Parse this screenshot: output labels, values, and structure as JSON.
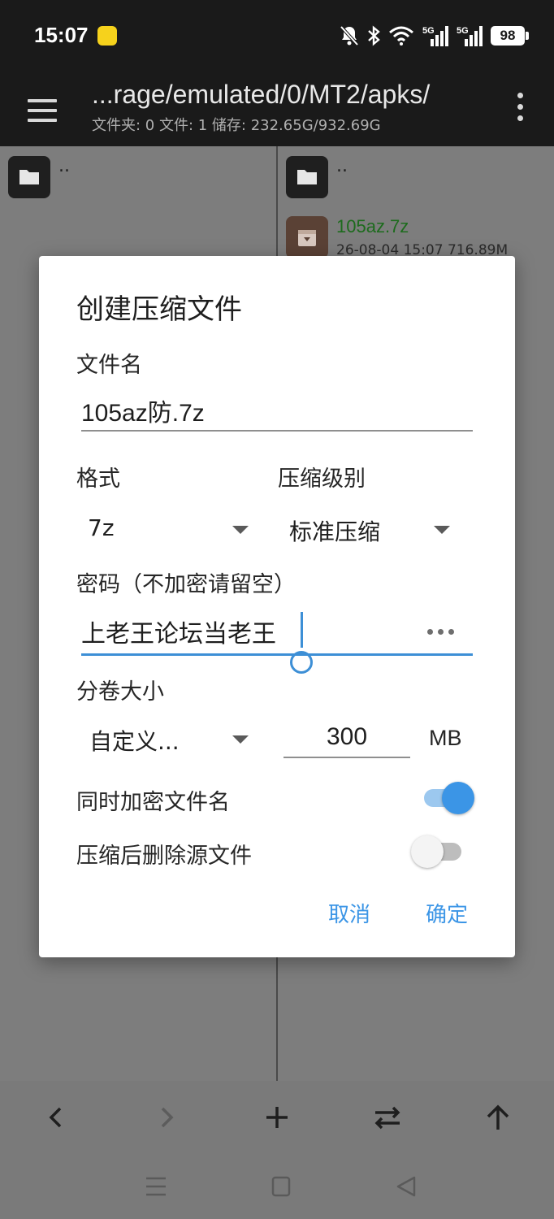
{
  "status_bar": {
    "time": "15:07",
    "battery": "98",
    "icons": [
      "app-badge-icon",
      "bell-off-icon",
      "bluetooth-icon",
      "wifi-icon",
      "signal-5g-icon",
      "signal-5g-icon"
    ]
  },
  "app_bar": {
    "path": "...rage/emulated/0/MT2/apks/",
    "info": "文件夹: 0  文件: 1  储存: 232.65G/932.69G"
  },
  "left_pane": {
    "items": [
      {
        "name": ".."
      }
    ]
  },
  "right_pane": {
    "items": [
      {
        "name": ".."
      },
      {
        "name": "105az.7z",
        "meta": "26-08-04 15:07  716.89M"
      }
    ]
  },
  "dialog": {
    "title": "创建压缩文件",
    "filename_label": "文件名",
    "filename_value": "105az防.7z",
    "format_label": "格式",
    "format_value": "7z",
    "level_label": "压缩级别",
    "level_value": "标准压缩",
    "password_label": "密码（不加密请留空）",
    "password_value": "上老王论坛当老王",
    "volume_label": "分卷大小",
    "volume_mode": "自定义...",
    "volume_size": "300",
    "volume_unit": "MB",
    "encrypt_names_label": "同时加密文件名",
    "encrypt_names_on": true,
    "delete_source_label": "压缩后删除源文件",
    "delete_source_on": false,
    "cancel_label": "取消",
    "ok_label": "确定"
  },
  "colors": {
    "accent": "#3b95e6",
    "dark_bar": "#1a1a1a",
    "scrim": "#7d7d7d"
  }
}
